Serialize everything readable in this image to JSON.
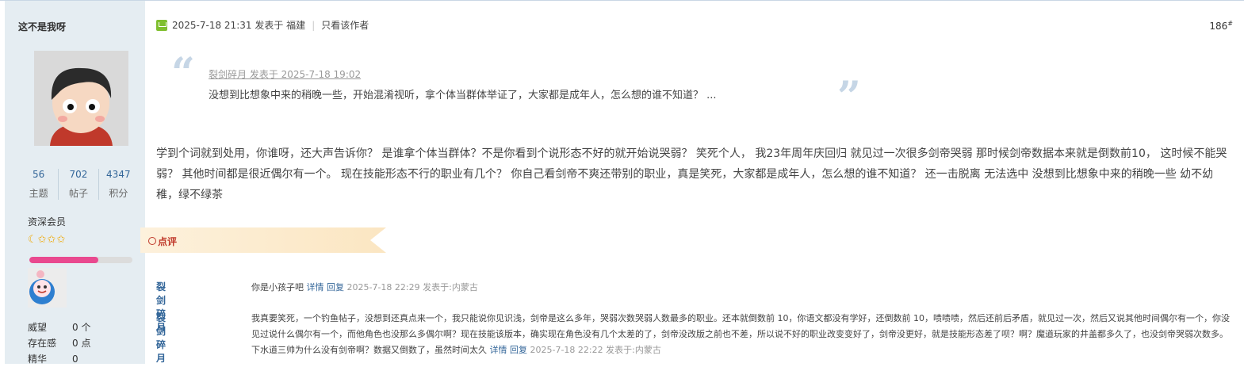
{
  "author": {
    "name": "这不是我呀",
    "stats": [
      {
        "value": "56",
        "label": "主题"
      },
      {
        "value": "702",
        "label": "帖子"
      },
      {
        "value": "4347",
        "label": "积分"
      }
    ],
    "group": "资深会员",
    "stars_glyphs": "☾✩✩✩",
    "progress": 0.67,
    "extra": [
      {
        "key": "威望",
        "value": "0 个"
      },
      {
        "key": "存在感",
        "value": "0 点"
      },
      {
        "key": "精华",
        "value": "0"
      }
    ]
  },
  "post": {
    "date": "2025-7-18 21:31",
    "posted_from_prefix": "发表于",
    "location": "福建",
    "only_author": "只看该作者",
    "floor": "186",
    "floor_sup": "#"
  },
  "quote": {
    "header": "裂剑碎月 发表于 2025-7-18 19:02",
    "body": "没想到比想象中来的稍晚一些，开始混淆视听，拿个体当群体举证了，大家都是成年人，怎么想的谁不知道？ ..."
  },
  "content": "学到个词就到处用，你谁呀，还大声告诉你？  是谁拿个体当群体？不是你看到个说形态不好的就开始说哭弱？ 笑死个人， 我23年周年庆回归 就见过一次很多剑帝哭弱 那时候剑帝数据本来就是倒数前10， 这时候不能哭弱？ 其他时间都是很近偶尔有一个。  现在技能形态不行的职业有几个？ 你自己看剑帝不爽还带别的职业，真是笑死，大家都是成年人，怎么想的谁不知道？ 还一击脱离 无法选中 没想到比想象中来的稍晚一些 幼不幼稚，绿不绿茶",
  "rating": {
    "label": "点评"
  },
  "comments": [
    {
      "user": "裂剑碎月",
      "text": "你是小孩子吧",
      "detail": "详情",
      "reply": "回复",
      "meta": "2025-7-18 22:29 发表于:内蒙古"
    },
    {
      "user": "裂剑碎月",
      "text": "我真要笑死，一个钓鱼帖子，没想到还真点来一个，我只能说你见识浅，剑帝是这么多年，哭弱次数哭弱人数最多的职业。还本就倒数前 10，你语文都没有学好，还倒数前 10，啧啧啧，然后还前后矛盾，就见过一次，然后又说其他时间偶尔有一个，你没见过说什么偶尔有一个，而他角色也没那么多偶尔啊？现在技能该版本，确实现在角色没有几个太差的了，剑帝没改版之前也不差，所以说不好的职业改变变好了，剑帝没更好，就是技能形态差了呗？啊？魔道玩家的井盖都多久了，也没剑帝哭弱次数多。下水道三帅为什么没有剑帝啊？数据又倒数了，虽然时间太久",
      "detail": "详情",
      "reply": "回复",
      "meta": "2025-7-18 22:22 发表于:内蒙古"
    }
  ]
}
